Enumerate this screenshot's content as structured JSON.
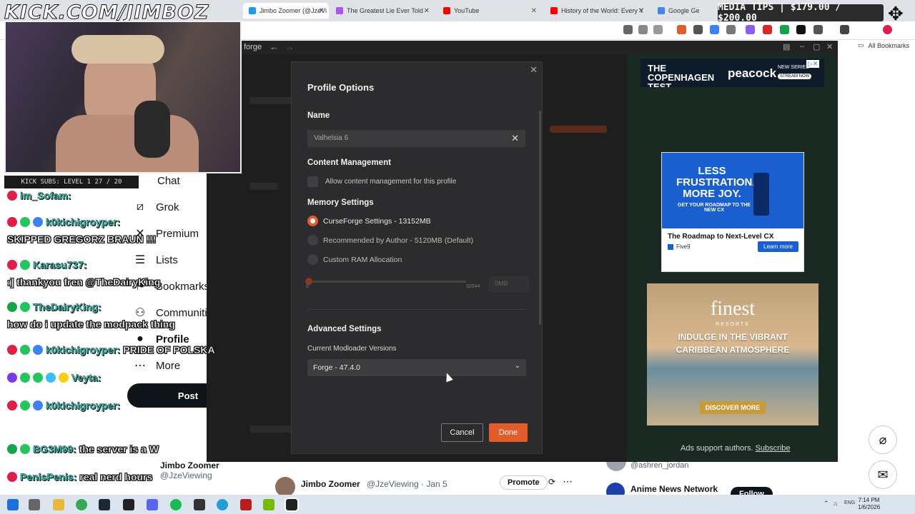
{
  "browser": {
    "tabs": [
      {
        "label": "Jimbo Zoomer (@JzeVi",
        "color": "#1d9bf0"
      },
      {
        "label": "The Greatest Lie Ever Told - ",
        "color": "#a855f7"
      },
      {
        "label": "YouTube",
        "color": "#ff0000"
      },
      {
        "label": "History of the World: Every Y",
        "color": "#ff0000"
      },
      {
        "label": "Google Ge",
        "color": "#4285f4"
      }
    ],
    "bookmarks_label": "All Bookmarks"
  },
  "stream": {
    "url_overlay": "KICK.COM/JIMBOZ",
    "kick_subs": "KICK SUBS: LEVEL 1  27 / 20",
    "media_tips": "MEDIA TIPS | $179.00 / $200.00",
    "chat": [
      {
        "user": "im_Sofam:",
        "message": ""
      },
      {
        "user": "k0kichigroyper:",
        "message": "SKIPPED GREGORZ BRAUN !!!"
      },
      {
        "user": "Karasu737:",
        "message": ":] thankyou fren @TheDairyKing"
      },
      {
        "user": "TheDairyKing:",
        "message": "how do i update the modpack thing"
      },
      {
        "user": "k0kichigroyper:",
        "message": "PRIDE OF POLSKA"
      },
      {
        "user": "Veyta:",
        "message": ""
      },
      {
        "user": "k0kichigroyper:",
        "message": ""
      },
      {
        "user": "BG3M99:",
        "message": "the server is a W"
      },
      {
        "user": "PenisPenis:",
        "message": "real nerd hours"
      }
    ]
  },
  "twitter": {
    "nav": [
      "Chat",
      "Grok",
      "Premium",
      "Lists",
      "Bookmarks",
      "Communities",
      "Profile",
      "More"
    ],
    "post_button": "Post",
    "user_name": "Jimbo Zoomer",
    "user_handle": "@JzeViewing",
    "feed_name": "Jimbo Zoomer",
    "feed_handle": "@JzeViewing · Jan 5",
    "promote": "Promote",
    "who_follow": [
      {
        "handle": "@ashren_jordan"
      },
      {
        "name": "Anime News Network",
        "button": "Follow"
      }
    ]
  },
  "app": {
    "title": "forge"
  },
  "modal": {
    "title": "Profile Options",
    "name_heading": "Name",
    "name_value": "Valhelsia 6",
    "content_heading": "Content Management",
    "content_checkbox": "Allow content management for this profile",
    "memory_heading": "Memory Settings",
    "memory_options": [
      {
        "label": "CurseForge Settings - 13152MB",
        "selected": true
      },
      {
        "label": "Recommended by Author - 5120MB (Default)",
        "selected": false
      },
      {
        "label": "Custom RAM Allocation",
        "selected": false
      }
    ],
    "slider_min": "0",
    "slider_max": "32544",
    "mb_value": "0MB",
    "advanced_heading": "Advanced Settings",
    "modloader_label": "Current Modloader Versions",
    "modloader_value": "Forge - 47.4.0",
    "cancel": "Cancel",
    "done": "Done"
  },
  "ads": {
    "peacock_text": "THE COPENHAGEN TEST",
    "peacock_brand": "peacock",
    "peacock_tag": "NEW SERIES",
    "peacock_cta": "STREAM NOW",
    "five9_headline": "LESS FRUSTRATION. MORE JOY.",
    "five9_sub": "GET YOUR ROADMAP TO THE NEW CX",
    "five9_title": "The Roadmap to Next-Level CX",
    "five9_brand": "Five9",
    "five9_cta": "Learn more",
    "finest_brand": "finest",
    "finest_sub": "RESORTS",
    "finest_headline": "INDULGE IN THE VIBRANT CARIBBEAN ATMOSPHERE",
    "finest_cta": "DISCOVER MORE",
    "support_text": "Ads support authors.",
    "support_link": "Subscribe"
  },
  "taskbar": {
    "lang": "ENG",
    "time": "7:14 PM",
    "date": "1/6/2026"
  }
}
